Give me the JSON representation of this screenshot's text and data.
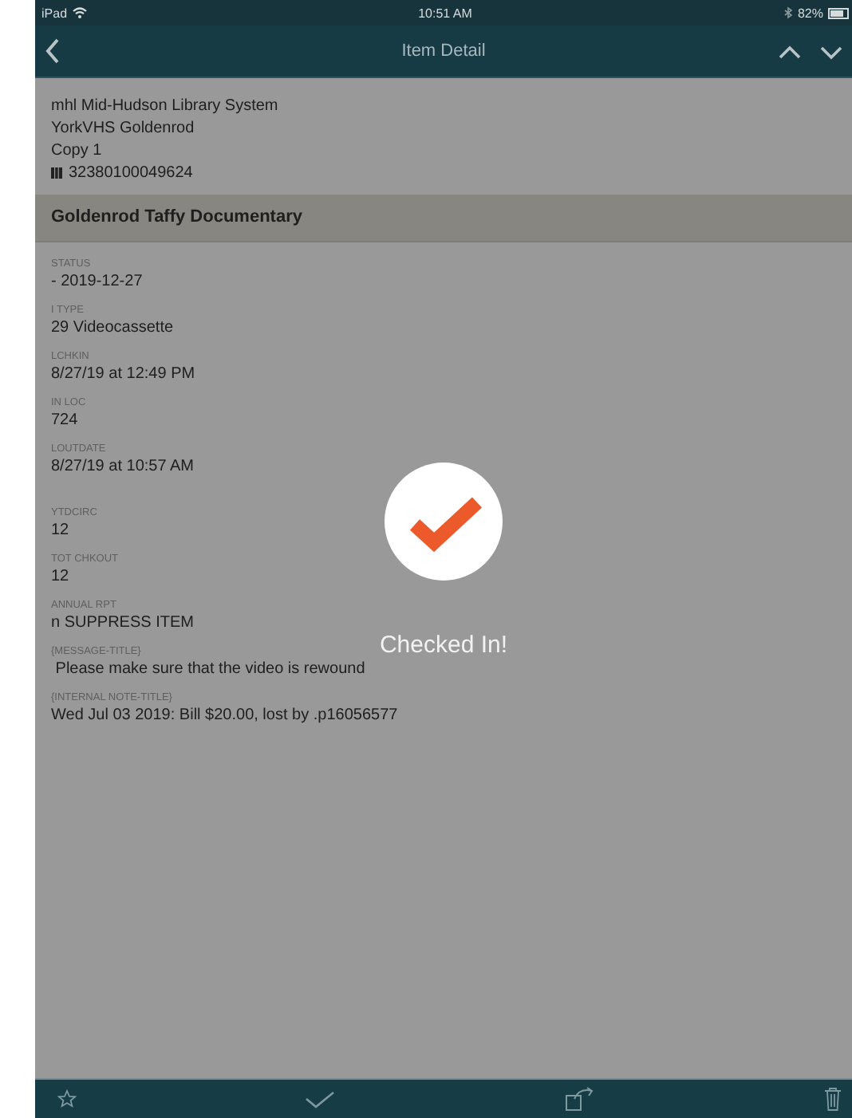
{
  "status_bar": {
    "device": "iPad",
    "time": "10:51 AM",
    "battery": "82%"
  },
  "nav_bar": {
    "title": "Item Detail"
  },
  "header": {
    "lines": [
      "mhl Mid-Hudson Library System",
      "YorkVHS Goldenrod",
      "Copy 1"
    ],
    "barcode": "32380100049624"
  },
  "title": "Goldenrod Taffy Documentary",
  "field_groups": [
    [
      {
        "label": "STATUS",
        "value": "- 2019-12-27"
      },
      {
        "label": "I TYPE",
        "value": "29 Videocassette"
      },
      {
        "label": "LCHKIN",
        "value": "8/27/19 at 12:49 PM"
      },
      {
        "label": "IN LOC",
        "value": "724"
      },
      {
        "label": "LOUTDATE",
        "value": "8/27/19 at 10:57 AM"
      }
    ],
    [
      {
        "label": "YTDCIRC",
        "value": "12"
      },
      {
        "label": "TOT CHKOUT",
        "value": "12"
      },
      {
        "label": "ANNUAL RPT",
        "value": "n SUPPRESS ITEM"
      },
      {
        "label": "{MESSAGE-TITLE}",
        "value": " Please make sure that the video is rewound"
      },
      {
        "label": "{INTERNAL NOTE-TITLE}",
        "value": "Wed Jul 03 2019: Bill $20.00, lost by .p16056577"
      }
    ]
  ],
  "toast": {
    "message": "Checked In!"
  },
  "toolbar": {
    "items": [
      {
        "kind": "star"
      },
      {
        "kind": "check"
      },
      {
        "kind": "transfer"
      },
      {
        "kind": "trash"
      }
    ]
  }
}
